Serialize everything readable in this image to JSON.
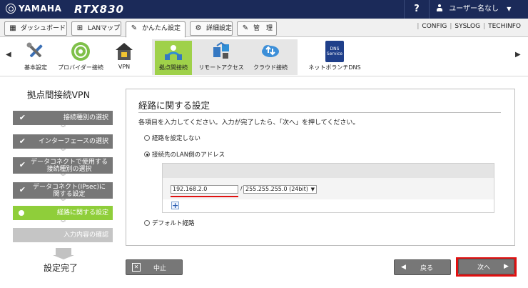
{
  "topbar": {
    "brand": "YAMAHA",
    "model": "RTX830",
    "help_label": "?",
    "user_label": "ユーザー名なし",
    "user_caret": "▼"
  },
  "tabs": [
    {
      "label": "ダッシュボード",
      "icon": "dashboard-icon",
      "glyph": "▦"
    },
    {
      "label": "LANマップ",
      "icon": "lan-map-icon",
      "glyph": "⊞"
    },
    {
      "label": "かんたん設定",
      "icon": "wizard-icon",
      "glyph": "✎"
    },
    {
      "label": "詳細設定",
      "icon": "gear-icon",
      "glyph": "⚙"
    },
    {
      "label": "管　理",
      "icon": "wrench-icon",
      "glyph": "✎"
    }
  ],
  "toplinks": [
    "CONFIG",
    "SYSLOG",
    "TECHINFO"
  ],
  "nav": {
    "prev_arrow": "◀",
    "next_arrow": "▶",
    "items": [
      {
        "label": "基本設定",
        "icon": "tools-icon"
      },
      {
        "label": "プロバイダー接続",
        "icon": "globe-icon"
      },
      {
        "label": "VPN",
        "icon": "lock-house-icon"
      },
      {
        "label": "拠点間接続",
        "icon": "site-vpn-icon"
      },
      {
        "label": "リモートアクセス",
        "icon": "remote-access-icon"
      },
      {
        "label": "クラウド接続",
        "icon": "cloud-icon"
      },
      {
        "label": "ネットボランチDNS",
        "icon": "dns-service-icon",
        "badge": "DNS Service"
      }
    ]
  },
  "wizard": {
    "title": "拠点間接続VPN",
    "steps": [
      {
        "label": "接続種別の選択",
        "state": "done"
      },
      {
        "label": "インターフェースの選択",
        "state": "done"
      },
      {
        "label": "データコネクトで使用する接続種別の選択",
        "state": "done"
      },
      {
        "label": "データコネクト(IPsec)に関する設定",
        "state": "done"
      },
      {
        "label": "経路に関する設定",
        "state": "current"
      },
      {
        "label": "入力内容の確認",
        "state": "pending"
      }
    ],
    "check_glyph": "✔",
    "chevron_glyph": "︾",
    "final_label": "設定完了"
  },
  "main": {
    "title": "経路に関する設定",
    "description": "各項目を入力してください。入力が完了したら、「次へ」を押してください。",
    "options": [
      {
        "label": "経路を設定しない",
        "selected": false
      },
      {
        "label": "接続先のLAN側のアドレス",
        "selected": true
      },
      {
        "label": "デフォルト経路",
        "selected": false
      }
    ],
    "address": {
      "ip_value": "192.168.2.0",
      "slash": "/",
      "mask_value": "255.255.255.0 (24bit)",
      "add_glyph": "+"
    }
  },
  "buttons": {
    "cancel": {
      "label": "中止",
      "glyph": "✕"
    },
    "back": {
      "label": "戻る",
      "glyph": "◀"
    },
    "next": {
      "label": "次へ",
      "glyph": "▶"
    }
  },
  "colors": {
    "topbar": "#1b2a59",
    "accent_green": "#8fce3a",
    "step_done": "#777777",
    "step_pending": "#c5c5c5",
    "highlight_red": "#e01010"
  }
}
